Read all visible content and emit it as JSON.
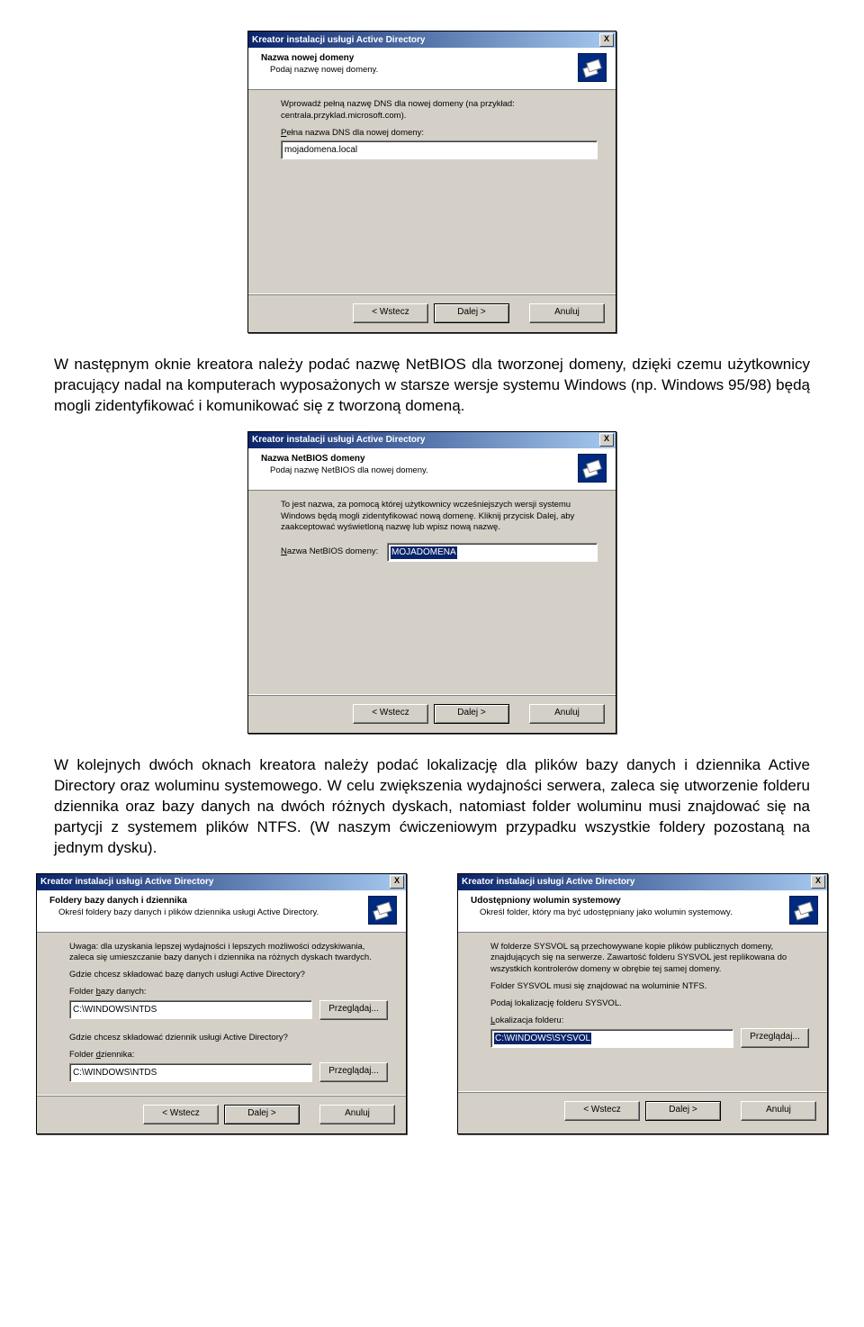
{
  "dialog_title": "Kreator instalacji usługi Active Directory",
  "close_x": "X",
  "buttons": {
    "back": "< Wstecz",
    "next": "Dalej >",
    "cancel": "Anuluj",
    "browse": "Przeglądaj..."
  },
  "d1": {
    "h1": "Nazwa nowej domeny",
    "h2": "Podaj nazwę nowej domeny.",
    "instr": "Wprowadź pełną nazwę DNS dla nowej domeny (na przykład: centrala.przyklad.microsoft.com).",
    "label_prefix": "P",
    "label_rest": "ełna nazwa DNS dla nowej domeny:",
    "value": "mojadomena.local"
  },
  "para1": "W następnym oknie kreatora należy podać nazwę NetBIOS dla tworzonej domeny, dzięki czemu użytkownicy pracujący nadal na komputerach wyposażonych w starsze wersje systemu Windows (np. Windows 95/98) będą mogli zidentyfikować i komunikować się z tworzoną domeną.",
  "d2": {
    "h1": "Nazwa NetBIOS domeny",
    "h2": "Podaj nazwę NetBIOS dla nowej domeny.",
    "instr": "To jest nazwa, za pomocą której użytkownicy wcześniejszych wersji systemu Windows będą mogli zidentyfikować nową domenę. Kliknij przycisk Dalej, aby zaakceptować wyświetloną nazwę lub wpisz nową nazwę.",
    "label_u": "N",
    "label_rest": "azwa NetBIOS domeny:",
    "value": "MOJADOMENA"
  },
  "para2": "W kolejnych dwóch oknach kreatora należy podać lokalizację dla plików bazy danych i dziennika Active Directory oraz woluminu systemowego. W celu zwiększenia wydajności serwera, zaleca się utworzenie folderu dziennika oraz bazy danych na dwóch różnych dyskach, natomiast folder woluminu musi znajdować się na partycji z systemem plików NTFS. (W naszym ćwiczeniowym przypadku wszystkie foldery pozostaną na jednym dysku).",
  "d3": {
    "h1": "Foldery bazy danych i dziennika",
    "h2": "Określ foldery bazy danych i plików dziennika usługi Active Directory.",
    "warn": "Uwaga: dla uzyskania lepszej wydajności i lepszych możliwości odzyskiwania, zaleca się umieszczanie bazy danych i dziennika na różnych dyskach twardych.",
    "q1": "Gdzie chcesz składować bazę danych usługi Active Directory?",
    "l1_u": "b",
    "l1_pre": "Folder ",
    "l1_post": "azy danych:",
    "v1": "C:\\WINDOWS\\NTDS",
    "q2": "Gdzie chcesz składować dziennik usługi Active Directory?",
    "l2_u": "d",
    "l2_pre": "Folder ",
    "l2_post": "ziennika:",
    "v2": "C:\\WINDOWS\\NTDS"
  },
  "d4": {
    "h1": "Udostępniony wolumin systemowy",
    "h2": "Określ folder, który ma być udostępniany jako wolumin systemowy.",
    "p1": "W folderze SYSVOL są przechowywane kopie plików publicznych domeny, znajdujących się na serwerze. Zawartość folderu SYSVOL jest replikowana do wszystkich kontrolerów domeny w obrębie tej samej domeny.",
    "p2": "Folder SYSVOL musi się znajdować na woluminie NTFS.",
    "p3": "Podaj lokalizację folderu SYSVOL.",
    "l_u": "L",
    "l_rest": "okalizacja folderu:",
    "value": "C:\\WINDOWS\\SYSVOL"
  }
}
